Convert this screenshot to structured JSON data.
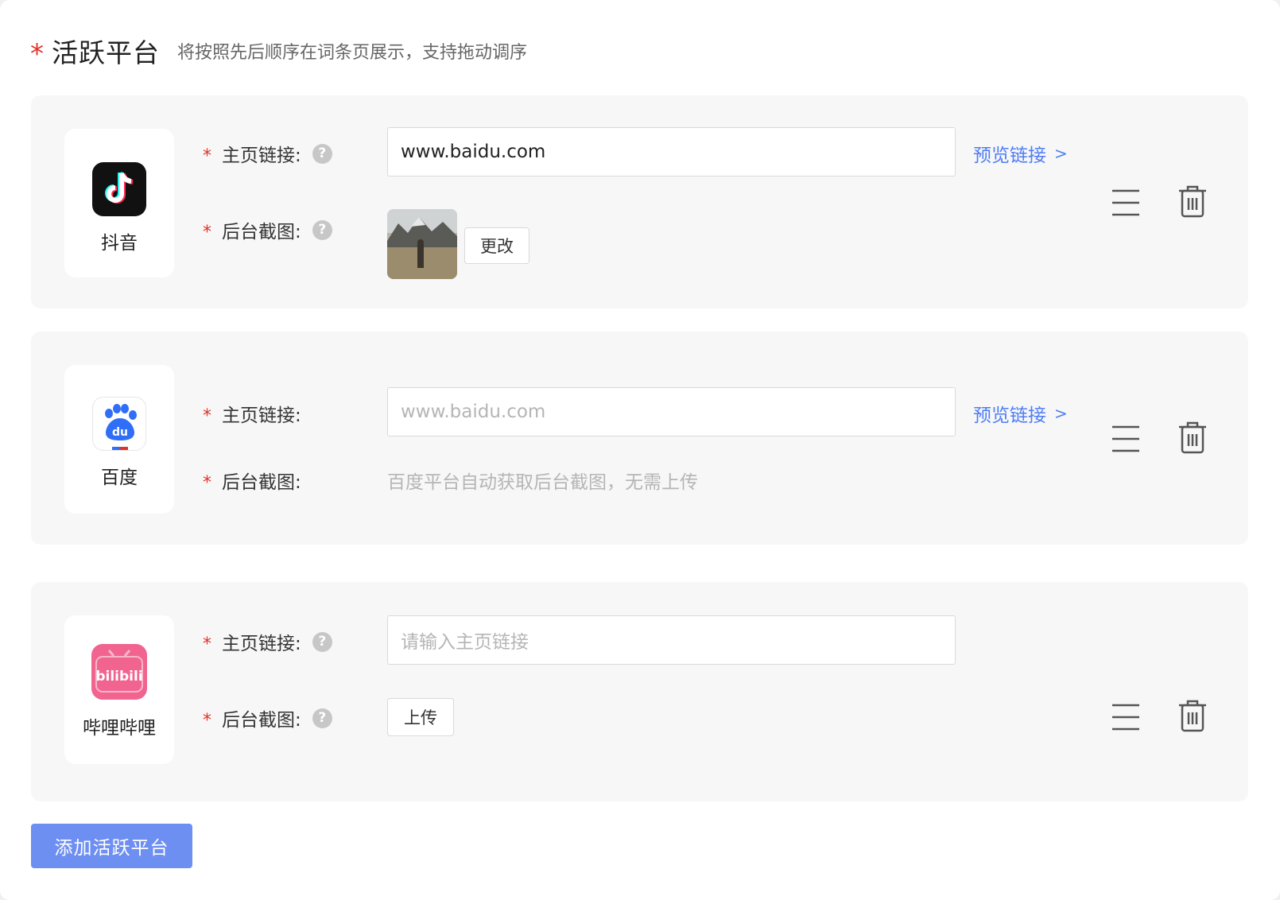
{
  "header": {
    "required_mark": "*",
    "title": "活跃平台",
    "hint": "将按照先后顺序在词条页展示，支持拖动调序"
  },
  "fields": {
    "required_mark": "*",
    "homepage_label": "主页链接:",
    "screenshot_label": "后台截图:",
    "help_mark": "?",
    "preview_label": "预览链接",
    "preview_chevron": ">"
  },
  "platforms": [
    {
      "name": "抖音",
      "icon": "douyin-icon",
      "url_value": "www.baidu.com",
      "screenshot_action": "更改"
    },
    {
      "name": "百度",
      "icon": "baidu-icon",
      "url_placeholder": "www.baidu.com",
      "screenshot_note": "百度平台自动获取后台截图，无需上传"
    },
    {
      "name": "哔哩哔哩",
      "icon": "bilibili-icon",
      "url_placeholder": "请输入主页链接",
      "screenshot_action": "上传"
    }
  ],
  "icons": {
    "drag": "drag-handle-icon",
    "delete": "trash-icon"
  },
  "add_button": "添加活跃平台",
  "colors": {
    "accent": "#4f7df5",
    "button_primary": "#6e8ff2",
    "required": "#e0342b",
    "card_bg": "#f7f7f7"
  }
}
